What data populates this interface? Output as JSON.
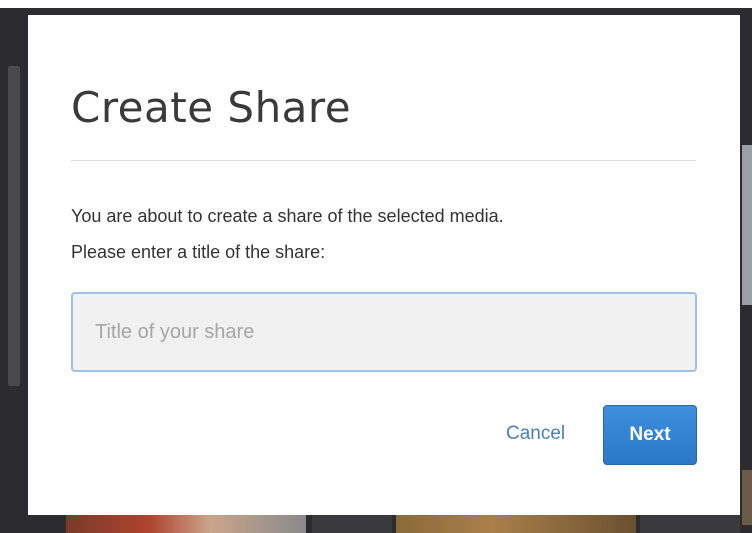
{
  "dialog": {
    "title": "Create Share",
    "description_line1": "You are about to create a share of the selected media.",
    "description_line2": "Please enter a title of the share:",
    "input": {
      "value": "",
      "placeholder": "Title of your share"
    },
    "cancel_label": "Cancel",
    "next_label": "Next"
  },
  "colors": {
    "primary_button": "#2a77c7",
    "link": "#4a7fb5",
    "input_focus_border": "#9ec1ec",
    "overlay_background": "#2c2c2e"
  }
}
